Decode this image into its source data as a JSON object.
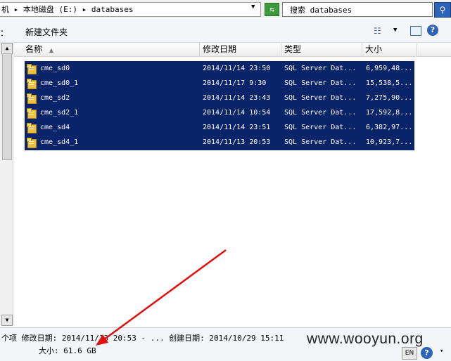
{
  "address_bar": {
    "path": "机 ▸ 本地磁盘 (E:) ▸ databases",
    "dropdown_icon": "chevron-down-icon",
    "go_icon": "refresh-arrows-icon"
  },
  "search": {
    "label": "搜索 databases",
    "icon": "search-icon"
  },
  "toolbar": {
    "stub_label": "：",
    "new_folder_label": "新建文件夹",
    "view_icon": "view-list-icon",
    "help_icon": "?"
  },
  "columns": {
    "name": "名称",
    "modified": "修改日期",
    "type": "类型",
    "size": "大小"
  },
  "files": [
    {
      "name": "cme_sd0",
      "modified": "2014/11/14 23:50",
      "type": "SQL Server Dat...",
      "size": "6,959,48..."
    },
    {
      "name": "cme_sd0_1",
      "modified": "2014/11/17 9:30",
      "type": "SQL Server Dat...",
      "size": "15,538,5..."
    },
    {
      "name": "cme_sd2",
      "modified": "2014/11/14 23:43",
      "type": "SQL Server Dat...",
      "size": "7,275,90..."
    },
    {
      "name": "cme_sd2_1",
      "modified": "2014/11/14 10:54",
      "type": "SQL Server Dat...",
      "size": "17,592,8..."
    },
    {
      "name": "cme_sd4",
      "modified": "2014/11/14 23:51",
      "type": "SQL Server Dat...",
      "size": "6,382,97..."
    },
    {
      "name": "cme_sd4_1",
      "modified": "2014/11/13 20:53",
      "type": "SQL Server Dat...",
      "size": "10,923,7..."
    }
  ],
  "status": {
    "line1": "个项  修改日期: 2014/11/13 20:53 - ...  创建日期: 2014/10/29 15:11",
    "line2": "大小: 61.6 GB"
  },
  "watermark": "www.wooyun.org",
  "taskbar": {
    "lang": "EN",
    "help": "?",
    "options": "▾"
  },
  "colors": {
    "selection": "#0a246a",
    "annotation_arrow": "#e01010"
  }
}
